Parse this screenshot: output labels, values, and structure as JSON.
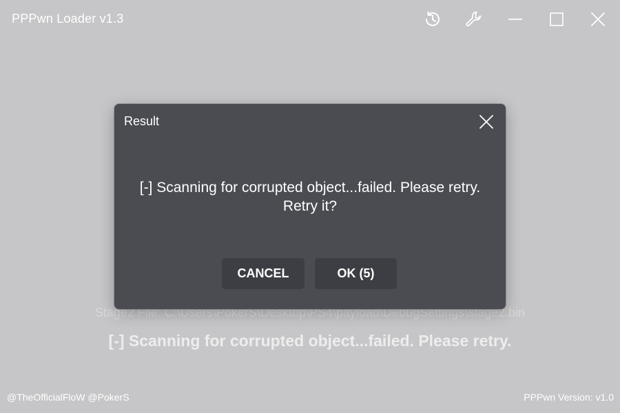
{
  "window": {
    "title": "PPPwn Loader v1.3",
    "icons": [
      "history-icon",
      "wrench-icon",
      "minimize-icon",
      "maximize-icon",
      "close-icon"
    ]
  },
  "background": {
    "stage2_file": "Stage2 File: C:\\Users\\PokerS\\Desktop\\PS4\\payload\\DebugSettings\\stage2.bin",
    "status": "[-] Scanning for corrupted object...failed. Please retry."
  },
  "footer": {
    "credits": "@TheOfficialFloW @PokerS",
    "version": "PPPwn Version: v1.0"
  },
  "dialog": {
    "title": "Result",
    "message": "[-] Scanning for corrupted object...failed. Please retry. Retry it?",
    "cancel_label": "CANCEL",
    "ok_label": "OK (5)"
  },
  "colors": {
    "window_bg": "#c6c6c8",
    "dialog_bg": "#4a4c52",
    "button_bg": "#3c3e43"
  }
}
